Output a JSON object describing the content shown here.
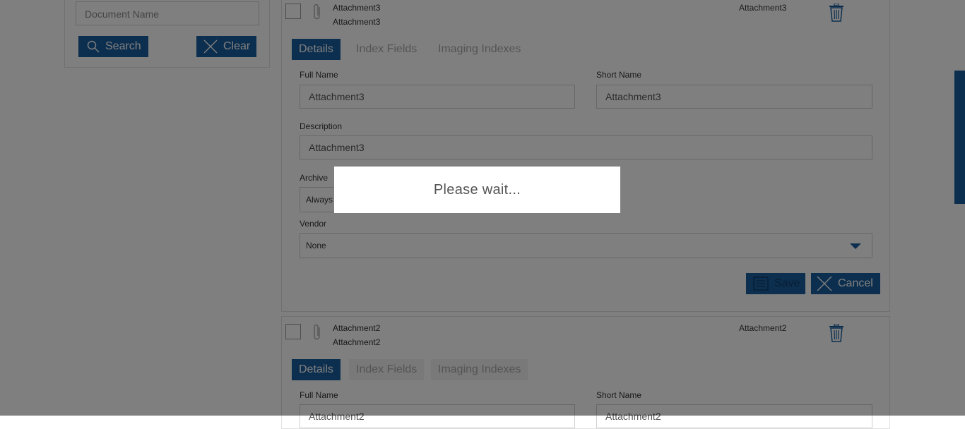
{
  "search_panel": {
    "document_name_placeholder": "Document Name",
    "search_label": "Search",
    "clear_label": "Clear"
  },
  "attachments": [
    {
      "name": "Attachment3",
      "subname": "Attachment3",
      "short_col": "Attachment3",
      "tabs": [
        "Details",
        "Index Fields",
        "Imaging Indexes"
      ],
      "full_name_label": "Full Name",
      "full_name_value": "Attachment3",
      "short_name_label": "Short Name",
      "short_name_value": "Attachment3",
      "description_label": "Description",
      "description_value": "Attachment3",
      "archive_label": "Archive",
      "archive_value": "Always",
      "vendor_label": "Vendor",
      "vendor_value": "None",
      "save_label": "Save",
      "cancel_label": "Cancel"
    },
    {
      "name": "Attachment2",
      "subname": "Attachment2",
      "short_col": "Attachment2",
      "tabs": [
        "Details",
        "Index Fields",
        "Imaging Indexes"
      ],
      "full_name_label": "Full Name",
      "full_name_value": "Attachment2",
      "short_name_label": "Short Name",
      "short_name_value": "Attachment2"
    }
  ],
  "overlay": {
    "message": "Please wait..."
  },
  "colors": {
    "accent": "#1b5e9e",
    "overlay": "rgba(0,0,0,0.5)"
  }
}
